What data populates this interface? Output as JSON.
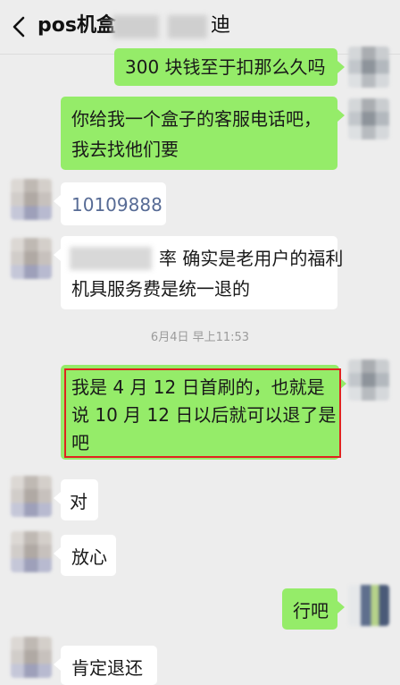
{
  "header": {
    "title": "pos机盒",
    "title_end": "迪",
    "back_icon": "chevron-left-icon"
  },
  "messages": [
    {
      "side": "out",
      "lines": [
        "300 块钱至于扣那么久吗"
      ]
    },
    {
      "side": "out",
      "lines": [
        "你给我一个盒子的客服电话吧，",
        "我去找他们要"
      ]
    },
    {
      "side": "in",
      "lines": [
        "10109888"
      ]
    },
    {
      "side": "in",
      "lines": [
        "率 确实是老用户的福利",
        "机具服务费是统一退的"
      ]
    },
    {
      "side": "out",
      "lines": [
        "我是 4 月 12 日首刷的，也就是",
        "说 10 月 12 日以后就可以退了是",
        "吧"
      ]
    },
    {
      "side": "in",
      "lines": [
        "对"
      ]
    },
    {
      "side": "in",
      "lines": [
        "放心"
      ]
    },
    {
      "side": "out",
      "lines": [
        "行吧"
      ]
    },
    {
      "side": "in",
      "lines": [
        "肯定退还"
      ]
    }
  ],
  "timestamp": "6月4日 早上11:53",
  "colors": {
    "background": "#ededed",
    "out_bubble": "#95ec69",
    "in_bubble": "#ffffff",
    "highlight_box": "#e0231f"
  }
}
